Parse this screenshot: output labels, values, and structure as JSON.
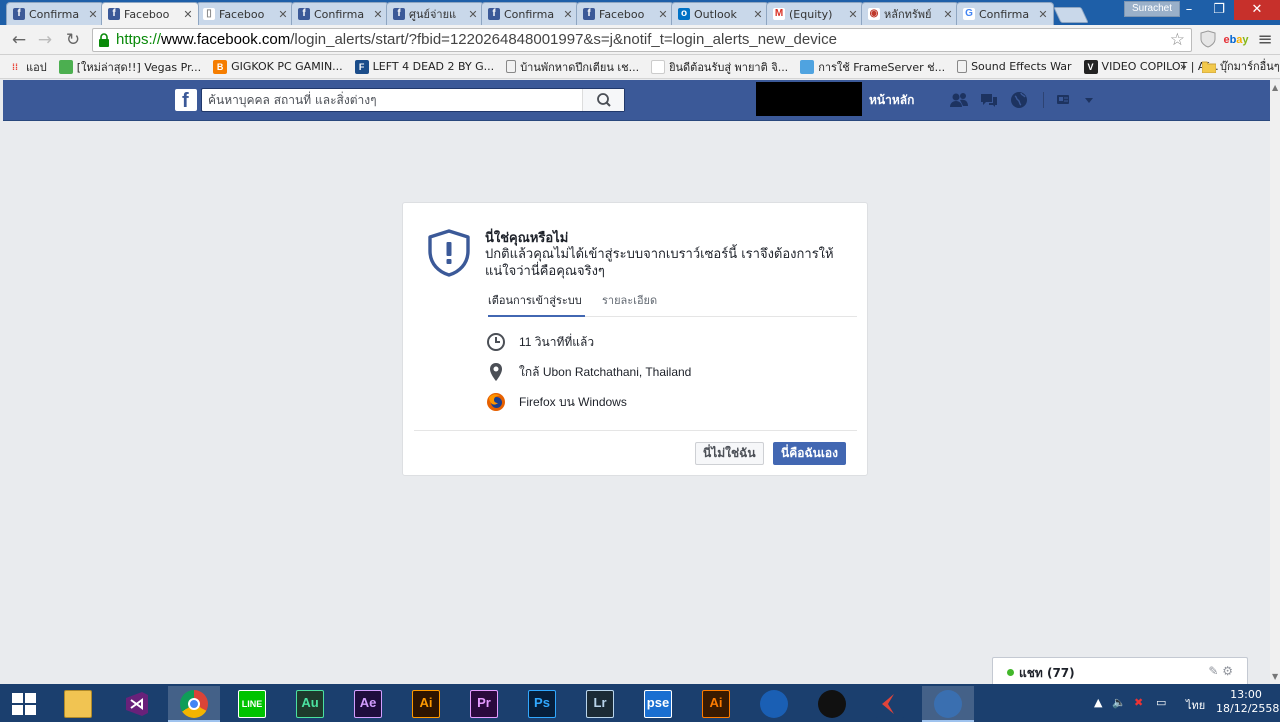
{
  "browser": {
    "tabs": [
      {
        "title": "Confirma",
        "favicon": "facebook-icon",
        "active": false
      },
      {
        "title": "Faceboo",
        "favicon": "facebook-icon",
        "active": true
      },
      {
        "title": "Faceboo",
        "favicon": "document-icon",
        "active": false
      },
      {
        "title": "Confirma",
        "favicon": "facebook-icon",
        "active": false
      },
      {
        "title": "ศูนย์จ่ายแ",
        "favicon": "facebook-icon",
        "active": false
      },
      {
        "title": "Confirma",
        "favicon": "facebook-icon",
        "active": false
      },
      {
        "title": "Faceboo",
        "favicon": "facebook-icon",
        "active": false
      },
      {
        "title": "Outlook",
        "favicon": "outlook-icon",
        "active": false
      },
      {
        "title": "(Equity)",
        "favicon": "gmail-icon",
        "active": false
      },
      {
        "title": "หลักทรัพย์",
        "favicon": "web-icon",
        "active": false
      },
      {
        "title": "Confirma",
        "favicon": "google-icon",
        "active": false
      }
    ],
    "close_glyph": "✕",
    "profile_name": "Surachet",
    "window_controls": {
      "minimize": "–",
      "restore": "❐",
      "close": "✕"
    },
    "url_scheme": "https://",
    "url_host": "www.facebook.com",
    "url_path": "/login_alerts/start/?fbid=1220264848001997&s=j&notif_t=login_alerts_new_device",
    "ebay_label": "ebay",
    "bookmarks": [
      {
        "label": "แอป",
        "icon": "apps-grid-icon",
        "color": "#e94235"
      },
      {
        "label": "[ใหม่ล่าสุด!!] Vegas Pr...",
        "icon": "new-badge-icon",
        "color": "#4caf50"
      },
      {
        "label": "GIGKOK PC GAMIN...",
        "icon": "blogger-icon",
        "color": "#f57d00"
      },
      {
        "label": "LEFT 4 DEAD 2 BY G...",
        "icon": "ft-icon",
        "color": "#1b4d8a"
      },
      {
        "label": "บ้านพักหาดปึกเตียน เช...",
        "icon": "page-icon",
        "color": "#888888"
      },
      {
        "label": "ยินดีต้อนรับสู่ พายาติ จิ...",
        "icon": "blank-icon",
        "color": "#ffffff"
      },
      {
        "label": "การใช้ FrameServer ช่...",
        "icon": "frameserver-icon",
        "color": "#4fa3e0"
      },
      {
        "label": "Sound Effects War",
        "icon": "page-icon",
        "color": "#888888"
      },
      {
        "label": "VIDEO COPILOT | Af...",
        "icon": "videocopilot-icon",
        "color": "#222222"
      }
    ],
    "bookmarks_more": "»",
    "other_bookmarks": "บุ๊กมาร์กอื่นๆ"
  },
  "facebook": {
    "logo": "f",
    "search_placeholder": "ค้นหาบุคคล สถานที่ และสิ่งต่างๆ",
    "home_label": "หน้าหลัก",
    "brand_color": "#3b5998"
  },
  "alert": {
    "title": "นี่ใช่คุณหรือไม่",
    "description": "ปกติแล้วคุณไม่ได้เข้าสู่ระบบจากเบราว์เซอร์นี้ เราจึงต้องการให้แน่ใจว่านี่คือคุณจริงๆ",
    "tabs": [
      "เตือนการเข้าสู่ระบบ",
      "รายละเอียด"
    ],
    "details": [
      {
        "icon": "clock-icon",
        "text": "11 วินาทีที่แล้ว"
      },
      {
        "icon": "location-pin-icon",
        "text": "ใกล้ Ubon Ratchathani, Thailand"
      },
      {
        "icon": "firefox-icon",
        "text": "Firefox บน Windows"
      }
    ],
    "not_me_button": "นี่ไม่ใช่ฉัน",
    "this_is_me_button": "นี่คือฉันเอง"
  },
  "chat": {
    "label": "แชท (77)",
    "status_color": "#42b72a"
  },
  "taskbar": {
    "apps": [
      {
        "name": "file-explorer-icon",
        "label": "",
        "bg": "#f1c452",
        "fg": "#7a5a10"
      },
      {
        "name": "visual-studio-icon",
        "label": "",
        "bg": "#68217a",
        "fg": "#ffffff"
      },
      {
        "name": "chrome-icon",
        "label": "",
        "bg": "#ffffff",
        "fg": "#ffffff",
        "selected": true
      },
      {
        "name": "line-icon",
        "label": "LINE",
        "bg": "#00c300",
        "fg": "#ffffff"
      },
      {
        "name": "audition-icon",
        "label": "Au",
        "bg": "#1e3b2c",
        "fg": "#4be1a0"
      },
      {
        "name": "after-effects-icon",
        "label": "Ae",
        "bg": "#1f0d3d",
        "fg": "#d39eff"
      },
      {
        "name": "illustrator-icon",
        "label": "Ai",
        "bg": "#2e1400",
        "fg": "#ff9a00"
      },
      {
        "name": "premiere-icon",
        "label": "Pr",
        "bg": "#2a0a3d",
        "fg": "#e59bff"
      },
      {
        "name": "photoshop-icon",
        "label": "Ps",
        "bg": "#061e3b",
        "fg": "#31a8ff"
      },
      {
        "name": "lightroom-icon",
        "label": "Lr",
        "bg": "#1b2b36",
        "fg": "#b9d5ec"
      },
      {
        "name": "photoshop-elements-icon",
        "label": "pse",
        "bg": "#1a6fd1",
        "fg": "#ffffff"
      },
      {
        "name": "illustrator-alt-icon",
        "label": "Ai",
        "bg": "#3a1a00",
        "fg": "#ff7c00"
      },
      {
        "name": "firefox-developer-icon",
        "label": "",
        "bg": "#1a5fb4",
        "fg": "#ffffff"
      },
      {
        "name": "game-booster-icon",
        "label": "",
        "bg": "#111111",
        "fg": "#ffffff"
      },
      {
        "name": "cubase-icon",
        "label": "",
        "bg": "#1b3f6e",
        "fg": "#e0443a"
      },
      {
        "name": "torrent-icon",
        "label": "",
        "bg": "#3a6fb0",
        "fg": "#ffffff",
        "selected": true
      }
    ],
    "language": "ไทย",
    "time": "13:00",
    "date": "18/12/2558"
  }
}
